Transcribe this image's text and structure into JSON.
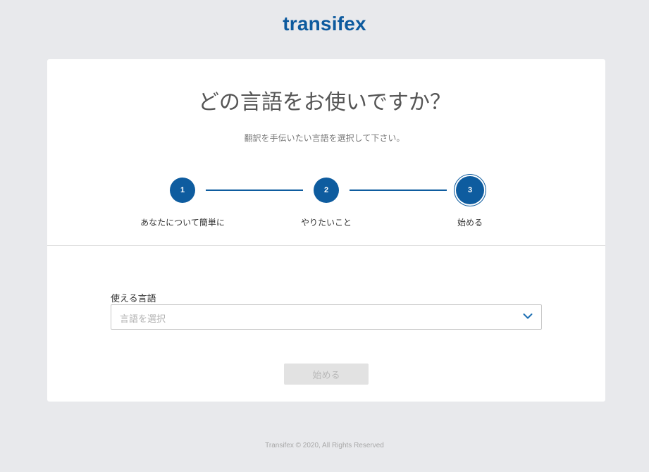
{
  "header": {
    "logo_text": "transifex"
  },
  "main": {
    "title": "どの言語をお使いですか？",
    "subtitle": "翻訳を手伝いたい言語を選択して下さい。"
  },
  "steps": [
    {
      "number": "1",
      "label": "あなたについて簡単に",
      "state": "completed"
    },
    {
      "number": "2",
      "label": "やりたいこと",
      "state": "completed"
    },
    {
      "number": "3",
      "label": "始める",
      "state": "active"
    }
  ],
  "form": {
    "language_label": "使える言語",
    "language_placeholder": "言語を選択",
    "start_button_label": "始める",
    "start_button_disabled": true
  },
  "footer": {
    "copyright": "Transifex © 2020, All Rights Reserved"
  },
  "colors": {
    "brand": "#0d5a9e",
    "background": "#e8e9ec",
    "card": "#ffffff",
    "disabled_button": "#e2e2e2"
  }
}
